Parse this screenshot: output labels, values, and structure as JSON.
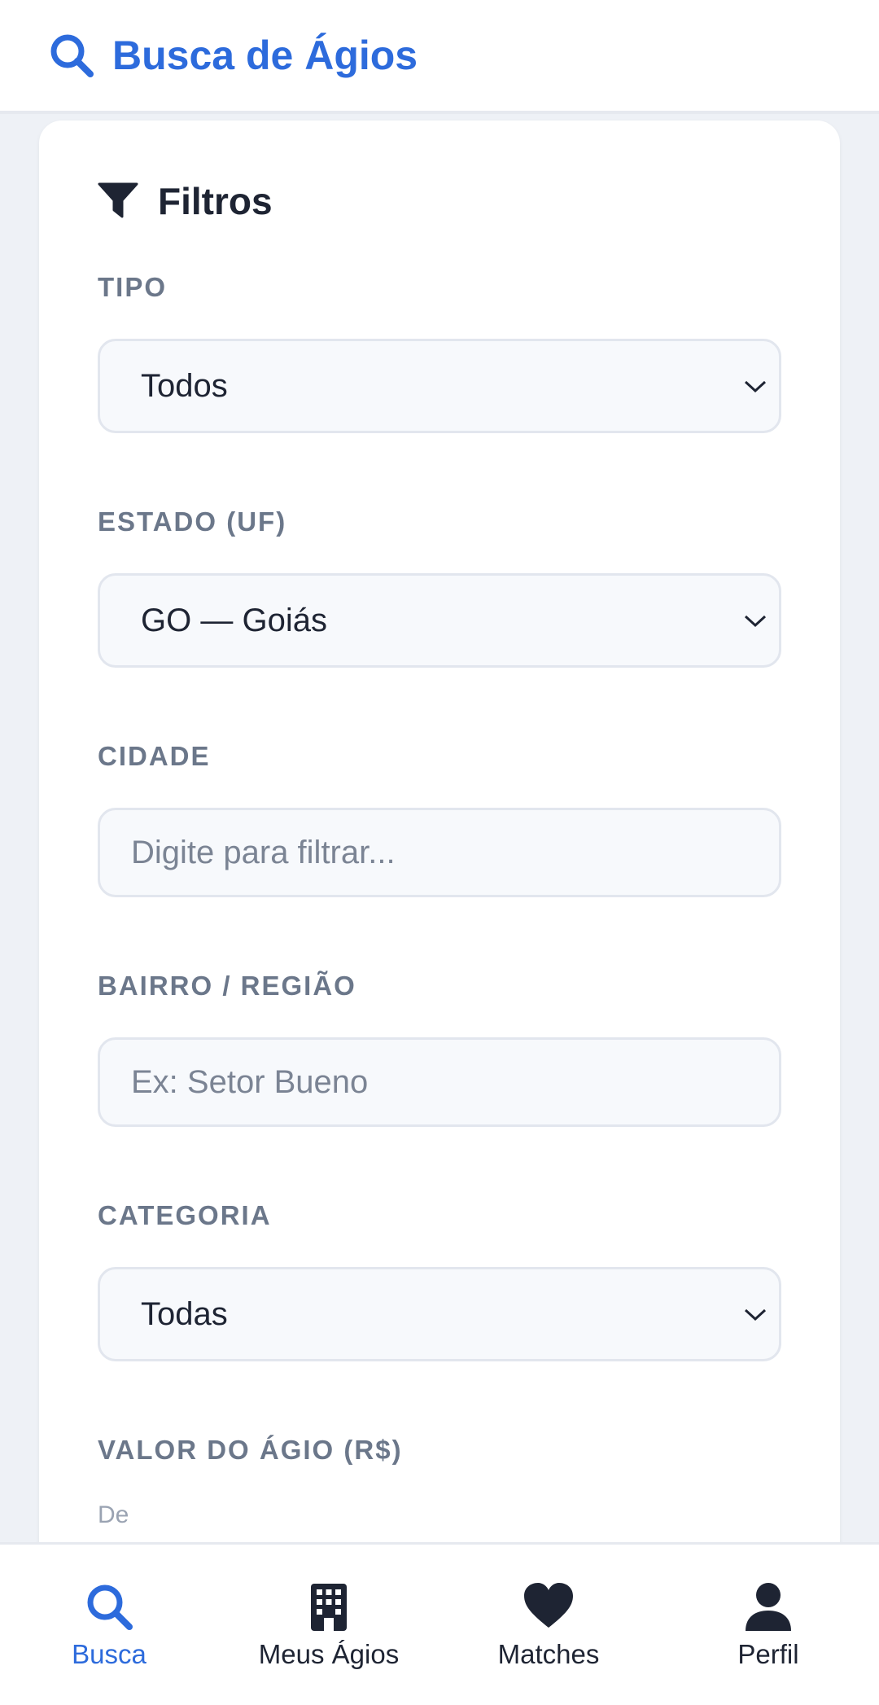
{
  "header": {
    "title": "Busca de Ágios",
    "icon": "search-icon",
    "color": "#2d6bdc"
  },
  "filters": {
    "title": "Filtros",
    "icon": "funnel-icon",
    "tipo": {
      "label": "TIPO",
      "value": "Todos"
    },
    "estado": {
      "label": "ESTADO (UF)",
      "value": "GO — Goiás"
    },
    "cidade": {
      "label": "CIDADE",
      "placeholder": "Digite para filtrar..."
    },
    "bairro": {
      "label": "BAIRRO / REGIÃO",
      "placeholder": "Ex: Setor Bueno"
    },
    "categoria": {
      "label": "CATEGORIA",
      "value": "Todas"
    },
    "valor": {
      "label": "VALOR DO ÁGIO (R$)",
      "de_label": "De"
    }
  },
  "bottom_nav": {
    "items": [
      {
        "label": "Busca",
        "icon": "search-icon",
        "active": true
      },
      {
        "label": "Meus Ágios",
        "icon": "building-icon",
        "active": false
      },
      {
        "label": "Matches",
        "icon": "heart-icon",
        "active": false
      },
      {
        "label": "Perfil",
        "icon": "user-icon",
        "active": false
      }
    ],
    "active_color": "#2d6bdc",
    "inactive_color": "#1e2433"
  }
}
